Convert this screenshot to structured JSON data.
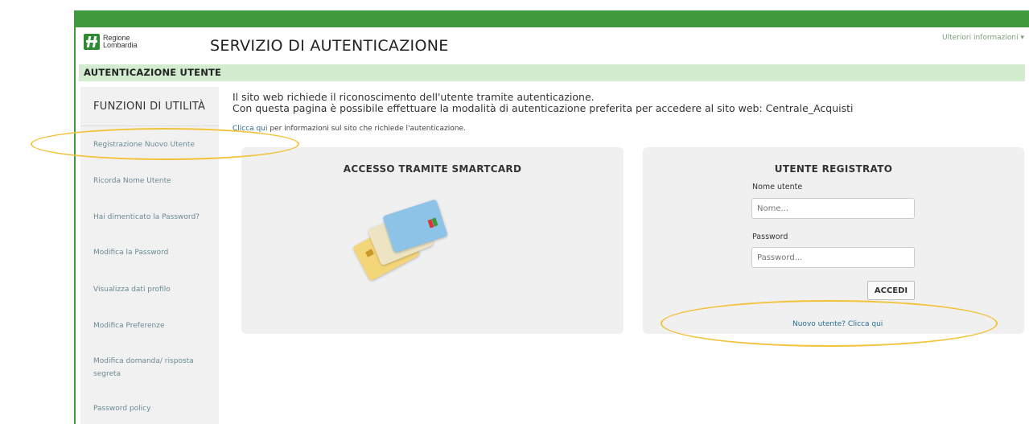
{
  "header": {
    "logo_line1": "Regione",
    "logo_line2": "Lombardia",
    "app_title": "SERVIZIO DI AUTENTICAZIONE",
    "more_info": "Ulteriori informazioni ▾"
  },
  "section": {
    "title": "AUTENTICAZIONE UTENTE"
  },
  "sidebar": {
    "title": "FUNZIONI DI UTILITÀ",
    "items": [
      {
        "label": "Registrazione Nuovo Utente"
      },
      {
        "label": "Ricorda Nome Utente"
      },
      {
        "label": "Hai dimenticato la Password?"
      },
      {
        "label": "Modifica la Password"
      },
      {
        "label": "Visualizza dati profilo"
      },
      {
        "label": "Modifica Preferenze"
      },
      {
        "label": "Modifica domanda/ risposta segreta"
      },
      {
        "label": "Password policy"
      }
    ]
  },
  "intro": {
    "line1": "Il sito web richiede il riconoscimento dell'utente tramite autenticazione.",
    "line2": "Con questa pagina è possibile effettuare la modalità di autenticazione preferita per accedere al sito web: Centrale_Acquisti",
    "link": "Clicca qui",
    "note": " per informazioni sul sito che richiede l'autenticazione."
  },
  "smartcard": {
    "title": "ACCESSO TRAMITE SMARTCARD"
  },
  "login": {
    "title": "UTENTE REGISTRATO",
    "username_label": "Nome utente",
    "username_placeholder": "Nome...",
    "password_label": "Password",
    "password_placeholder": "Password...",
    "submit_label": "ACCEDI",
    "new_user_link": "Nuovo utente? Clicca qui"
  },
  "colors": {
    "brand_green": "#3f9a3b",
    "section_bar": "#d3ecd0",
    "highlight": "#f2c23a",
    "link": "#2a6f8e"
  }
}
